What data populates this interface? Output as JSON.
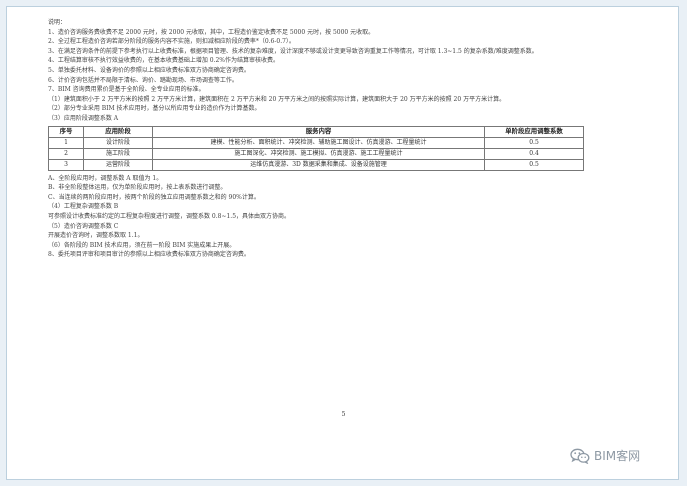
{
  "document": {
    "heading": "说明：",
    "items": [
      "1、造价咨询服务费收费不足 2000 元时，按 2000 元收取，其中，工程造价鉴定收费不足 5000 元时，按 5000 元收取。",
      "2、全过程工程造价咨询若部分阶段的服务内容不实施，则扣减相应阶段的费率*（0.6-0.7）。",
      "3、在满足咨询条件的前提下参考执行以上收费标准，根据项目管理、技术的复杂难度，设计深度不够或设计变更导致咨询重复工作等情况，可计取 1.3~1.5 的复杂系数/难度调整系数。",
      "4、工程结算审核不执行效益收费的，在基本收费基础上增加 0.2%作为结算审核收费。",
      "5、单独委托材料、设备询价的参照以上相应收费标准双方协商确定咨询费。",
      "6、计价咨询包括并不局限于清标、询价、踏勘现场、市场调查等工作。",
      "7、BIM 咨询费用累价是基于全阶段、全专业应用的标准。",
      "（1）建筑面积小于 2 万平方米的按照 2 万平方米计算，建筑面积在 2 万平方米和 20 万平方米之间的按照实际计算，建筑面积大于 20 万平方米的按照 20 万平方米计算。",
      "（2）部分专业采用 BIM 技术应用时，基分以所应用专业的造价作为计算基数。",
      "（3）应用阶段调整系数 A"
    ],
    "table": {
      "headers": [
        "序号",
        "应用阶段",
        "服务内容",
        "单阶段应用调整系数"
      ],
      "rows": [
        [
          "1",
          "设计阶段",
          "建模、性能分析、面积统计、冲突检测、辅助施工图设计、仿真漫游、工程量统计",
          "0.5"
        ],
        [
          "2",
          "施工阶段",
          "施工图深化、冲突检测、施工模拟、仿真漫游、施工工程量统计",
          "0.4"
        ],
        [
          "3",
          "运营阶段",
          "运维仿真漫游、3D 数据采集和集成、设备设施管理",
          "0.5"
        ]
      ]
    },
    "after": [
      "A、全阶段应用时，调整系数 A 取值为 1。",
      "B、非全阶段整体运用，仅为单阶段应用时，按上表系数进行调整。",
      "C、当连续的两阶段应用时，按两个阶段的独立应用调整系数之和的 90%计算。",
      "（4）工程复杂调整系数 B",
      "可参照设计收费标准约定的工程复杂程度进行调整，调整系数 0.8~1.5，具体由双方协商。",
      "（5）造价咨询调整系数 C",
      "开展造价咨询时，调整系数取 1.1。",
      "（6）各阶段的 BIM 技术应用，须在前一阶段 BIM 实施成果上开展。",
      "8、委托项目评审和项目审计的参照以上相应收费标准双方协商确定咨询费。"
    ],
    "page_number": "5"
  },
  "watermark": {
    "text": "BIM客网",
    "icon": "wechat-icon",
    "color": "#8e99a4"
  }
}
